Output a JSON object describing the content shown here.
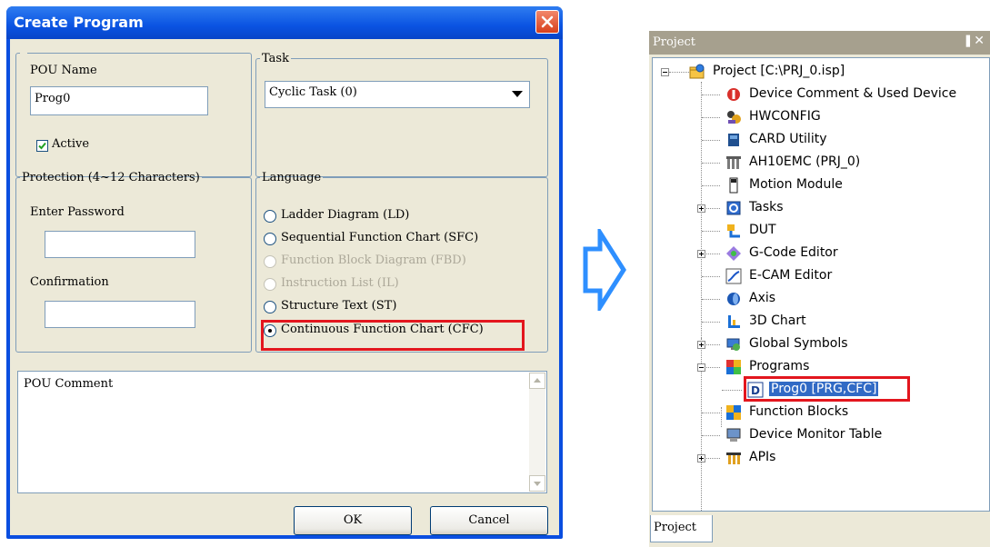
{
  "dialog": {
    "title": "Create Program",
    "pou_name_label": "POU Name",
    "pou_name_value": "Prog0",
    "active_label": "Active",
    "active_checked": true,
    "task_legend": "Task",
    "task_value": "Cyclic Task (0)",
    "protection_legend": "Protection (4~12 Characters)",
    "password_label": "Enter Password",
    "password_value": "",
    "confirmation_label": "Confirmation",
    "confirmation_value": "",
    "language_legend": "Language",
    "languages": [
      {
        "label": "Ladder Diagram (LD)",
        "enabled": true,
        "selected": false
      },
      {
        "label": "Sequential Function Chart (SFC)",
        "enabled": true,
        "selected": false
      },
      {
        "label": "Function Block Diagram (FBD)",
        "enabled": false,
        "selected": false
      },
      {
        "label": "Instruction List (IL)",
        "enabled": false,
        "selected": false
      },
      {
        "label": "Structure Text (ST)",
        "enabled": true,
        "selected": false
      },
      {
        "label": "Continuous Function Chart (CFC)",
        "enabled": true,
        "selected": true
      }
    ],
    "comment_text": "POU Comment",
    "ok_label": "OK",
    "cancel_label": "Cancel"
  },
  "project_pane": {
    "title": "Project",
    "tab_label": "Project",
    "tree": [
      {
        "label": "Project [C:\\PRJ_0.isp]",
        "icon": "project-folder-icon"
      },
      {
        "label": "Device Comment & Used Device",
        "icon": "device-comment-icon"
      },
      {
        "label": "HWCONFIG",
        "icon": "hwconfig-icon"
      },
      {
        "label": "CARD Utility",
        "icon": "card-icon"
      },
      {
        "label": "AH10EMC  (PRJ_0)",
        "icon": "module-icon"
      },
      {
        "label": "Motion Module",
        "icon": "motion-module-icon"
      },
      {
        "label": "Tasks",
        "icon": "tasks-icon"
      },
      {
        "label": "DUT",
        "icon": "dut-icon"
      },
      {
        "label": "G-Code Editor",
        "icon": "gcode-icon"
      },
      {
        "label": "E-CAM Editor",
        "icon": "ecam-icon"
      },
      {
        "label": "Axis",
        "icon": "axis-icon"
      },
      {
        "label": "3D Chart",
        "icon": "3d-chart-icon"
      },
      {
        "label": "Global Symbols",
        "icon": "global-symbols-icon"
      },
      {
        "label": "Programs",
        "icon": "programs-icon"
      },
      {
        "label": "Prog0 [PRG,CFC]",
        "icon": "cfc-program-icon",
        "selected": true
      },
      {
        "label": "Function Blocks",
        "icon": "function-blocks-icon"
      },
      {
        "label": "Device Monitor Table",
        "icon": "monitor-table-icon"
      },
      {
        "label": "APIs",
        "icon": "apis-icon"
      }
    ]
  },
  "colors": {
    "title_bar": "#0a53e2",
    "dialog_bg": "#ece9d8",
    "highlight_border": "#e3161e",
    "selection": "#316ac5",
    "arrow": "#2e8fff"
  }
}
